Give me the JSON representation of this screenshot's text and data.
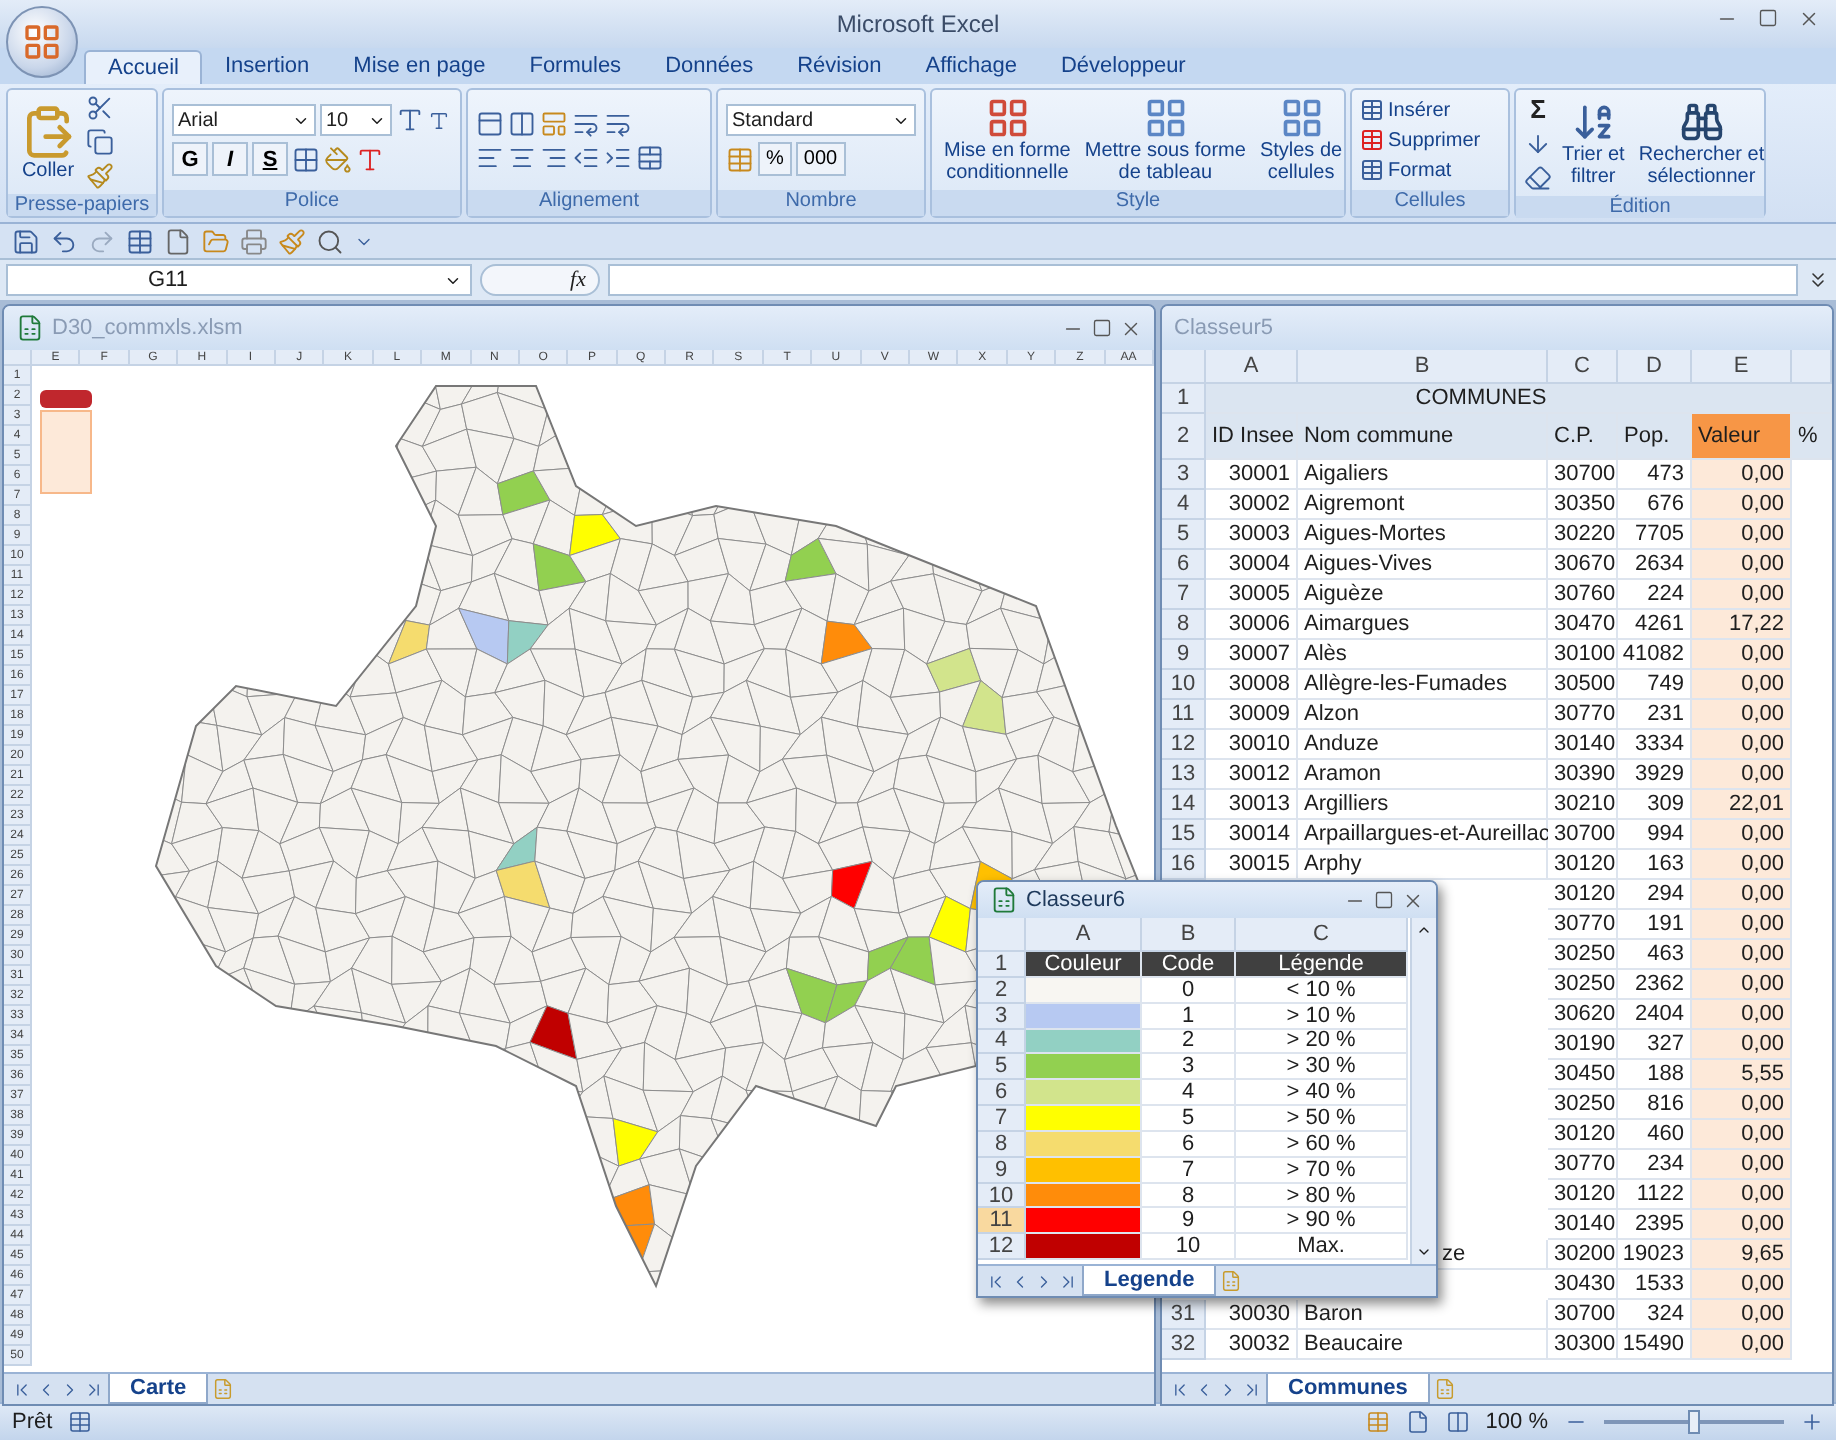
{
  "app": {
    "title": "Microsoft Excel"
  },
  "tabs": [
    {
      "label": "Accueil",
      "selected": true
    },
    {
      "label": "Insertion",
      "selected": false
    },
    {
      "label": "Mise en page",
      "selected": false
    },
    {
      "label": "Formules",
      "selected": false
    },
    {
      "label": "Données",
      "selected": false
    },
    {
      "label": "Révision",
      "selected": false
    },
    {
      "label": "Affichage",
      "selected": false
    },
    {
      "label": "Développeur",
      "selected": false
    }
  ],
  "ribbon": {
    "groups": [
      {
        "kind": "clipboard",
        "label": "Presse-papiers",
        "button": "Coller"
      },
      {
        "kind": "font",
        "label": "Police",
        "font": "Arial",
        "size": "10",
        "styles": [
          "G",
          "I",
          "S"
        ]
      },
      {
        "kind": "alignment",
        "label": "Alignement"
      },
      {
        "kind": "number",
        "label": "Nombre",
        "format": "Standard",
        "symbols": [
          "%",
          "000"
        ]
      },
      {
        "kind": "style",
        "label": "Style",
        "buttons": [
          {
            "lines": [
              "Mise en forme",
              "conditionnelle"
            ]
          },
          {
            "lines": [
              "Mettre sous forme",
              "de tableau"
            ]
          },
          {
            "lines": [
              "Styles de",
              "cellules"
            ]
          }
        ]
      },
      {
        "kind": "cells",
        "label": "Cellules",
        "buttons": [
          "Insérer",
          "Supprimer",
          "Format"
        ]
      },
      {
        "kind": "editing",
        "label": "Édition",
        "sum": "Σ",
        "buttons": [
          {
            "lines": [
              "Trier et",
              "filtrer"
            ]
          },
          {
            "lines": [
              "Rechercher et",
              "sélectionner"
            ]
          }
        ]
      }
    ]
  },
  "formula_bar": {
    "name_box": "G11",
    "function_label": "fx"
  },
  "map_window": {
    "title": "D30_commxls.xlsm",
    "active": false,
    "columns": [
      "E",
      "F",
      "G",
      "H",
      "I",
      "J",
      "K",
      "L",
      "M",
      "N",
      "O",
      "P",
      "Q",
      "R",
      "S",
      "T",
      "U",
      "V",
      "W",
      "X",
      "Y",
      "Z",
      "AA"
    ],
    "row_headers": [
      "1",
      "2",
      "3",
      "4",
      "5",
      "6",
      "7",
      "8",
      "9",
      "10",
      "11",
      "12",
      "13",
      "14",
      "15",
      "16",
      "17",
      "18",
      "19",
      "20",
      "21",
      "22",
      "23",
      "24",
      "25",
      "26",
      "27",
      "28",
      "29",
      "30",
      "31",
      "32",
      "33",
      "34",
      "35",
      "36",
      "37",
      "38",
      "39",
      "40",
      "41",
      "42",
      "43",
      "44",
      "45",
      "46",
      "47",
      "48",
      "49",
      "50"
    ],
    "sheet_tabs": [
      {
        "label": "Carte",
        "selected": true
      }
    ]
  },
  "communes_window": {
    "title": "Classeur5",
    "active": false,
    "columns": [
      "A",
      "B",
      "C",
      "D",
      "E"
    ],
    "title_row": {
      "row": "1",
      "text": "COMMUNES"
    },
    "header_row": {
      "row": "2",
      "cells": [
        "ID Insee",
        "Nom commune",
        "C.P.",
        "Pop.",
        "Valeur",
        "%"
      ]
    },
    "rows": [
      {
        "kind": "full",
        "row": "3",
        "id": "30001",
        "name": "Aigaliers",
        "cp": "30700",
        "pop": "473",
        "value": "0,00"
      },
      {
        "kind": "full",
        "row": "4",
        "id": "30002",
        "name": "Aigremont",
        "cp": "30350",
        "pop": "676",
        "value": "0,00"
      },
      {
        "kind": "full",
        "row": "5",
        "id": "30003",
        "name": "Aigues-Mortes",
        "cp": "30220",
        "pop": "7705",
        "value": "0,00"
      },
      {
        "kind": "full",
        "row": "6",
        "id": "30004",
        "name": "Aigues-Vives",
        "cp": "30670",
        "pop": "2634",
        "value": "0,00"
      },
      {
        "kind": "full",
        "row": "7",
        "id": "30005",
        "name": "Aiguèze",
        "cp": "30760",
        "pop": "224",
        "value": "0,00"
      },
      {
        "kind": "full",
        "row": "8",
        "id": "30006",
        "name": "Aimargues",
        "cp": "30470",
        "pop": "4261",
        "value": "17,22"
      },
      {
        "kind": "full",
        "row": "9",
        "id": "30007",
        "name": "Alès",
        "cp": "30100",
        "pop": "41082",
        "value": "0,00"
      },
      {
        "kind": "full",
        "row": "10",
        "id": "30008",
        "name": "Allègre-les-Fumades",
        "cp": "30500",
        "pop": "749",
        "value": "0,00"
      },
      {
        "kind": "full",
        "row": "11",
        "id": "30009",
        "name": "Alzon",
        "cp": "30770",
        "pop": "231",
        "value": "0,00"
      },
      {
        "kind": "full",
        "row": "12",
        "id": "30010",
        "name": "Anduze",
        "cp": "30140",
        "pop": "3334",
        "value": "0,00"
      },
      {
        "kind": "full",
        "row": "13",
        "id": "30012",
        "name": "Aramon",
        "cp": "30390",
        "pop": "3929",
        "value": "0,00"
      },
      {
        "kind": "full",
        "row": "14",
        "id": "30013",
        "name": "Argilliers",
        "cp": "30210",
        "pop": "309",
        "value": "22,01"
      },
      {
        "kind": "full",
        "row": "15",
        "id": "30014",
        "name": "Arpaillargues-et-Aureillac",
        "cp": "30700",
        "pop": "994",
        "value": "0,00"
      },
      {
        "kind": "full",
        "row": "16",
        "id": "30015",
        "name": "Arphy",
        "cp": "30120",
        "pop": "163",
        "value": "0,00"
      },
      {
        "kind": "covered",
        "cp": "30120",
        "pop": "294",
        "value": "0,00"
      },
      {
        "kind": "covered",
        "cp": "30770",
        "pop": "191",
        "value": "0,00"
      },
      {
        "kind": "covered",
        "cp": "30250",
        "pop": "463",
        "value": "0,00"
      },
      {
        "kind": "covered",
        "cp": "30250",
        "pop": "2362",
        "value": "0,00"
      },
      {
        "kind": "covered",
        "cp": "30620",
        "pop": "2404",
        "value": "0,00"
      },
      {
        "kind": "covered",
        "cp": "30190",
        "pop": "327",
        "value": "0,00"
      },
      {
        "kind": "covered",
        "cp": "30450",
        "pop": "188",
        "value": "5,55"
      },
      {
        "kind": "covered",
        "cp": "30250",
        "pop": "816",
        "value": "0,00"
      },
      {
        "kind": "covered",
        "cp": "30120",
        "pop": "460",
        "value": "0,00"
      },
      {
        "kind": "covered",
        "cp": "30770",
        "pop": "234",
        "value": "0,00"
      },
      {
        "kind": "covered",
        "cp": "30120",
        "pop": "1122",
        "value": "0,00"
      },
      {
        "kind": "covered",
        "cp": "30140",
        "pop": "2395",
        "value": "0,00"
      },
      {
        "kind": "covered",
        "name": "ze",
        "cp": "30200",
        "pop": "19023",
        "value": "9,65"
      },
      {
        "kind": "covered",
        "cp": "30430",
        "pop": "1533",
        "value": "0,00"
      },
      {
        "kind": "full",
        "row": "31",
        "id": "30030",
        "name": "Baron",
        "cp": "30700",
        "pop": "324",
        "value": "0,00"
      },
      {
        "kind": "full",
        "row": "32",
        "id": "30032",
        "name": "Beaucaire",
        "cp": "30300",
        "pop": "15490",
        "value": "0,00"
      }
    ],
    "sheet_tabs": [
      {
        "label": "Communes",
        "selected": true
      }
    ]
  },
  "legend_window": {
    "title": "Classeur6",
    "active": true,
    "columns": [
      "A",
      "B",
      "C"
    ],
    "header": {
      "row": "1",
      "cells": [
        "Couleur",
        "Code",
        "Légende"
      ]
    },
    "rows": [
      {
        "row": "2",
        "color": "#f8f6f2",
        "code": "0",
        "legend": "< 10 %",
        "selected": false
      },
      {
        "row": "3",
        "color": "#b7c9f2",
        "code": "1",
        "legend": "> 10 %",
        "selected": false
      },
      {
        "row": "4",
        "color": "#92d0c3",
        "code": "2",
        "legend": "> 20 %",
        "selected": false
      },
      {
        "row": "5",
        "color": "#92d050",
        "code": "3",
        "legend": "> 30 %",
        "selected": false
      },
      {
        "row": "6",
        "color": "#d2e48c",
        "code": "4",
        "legend": "> 40 %",
        "selected": false
      },
      {
        "row": "7",
        "color": "#ffff00",
        "code": "5",
        "legend": "> 50 %",
        "selected": false
      },
      {
        "row": "8",
        "color": "#f5dc6e",
        "code": "6",
        "legend": "> 60 %",
        "selected": false
      },
      {
        "row": "9",
        "color": "#ffc000",
        "code": "7",
        "legend": "> 70 %",
        "selected": false
      },
      {
        "row": "10",
        "color": "#ff8c0a",
        "code": "8",
        "legend": "> 80 %",
        "selected": false
      },
      {
        "row": "11",
        "color": "#ff0000",
        "code": "9",
        "legend": "> 90 %",
        "selected": true
      },
      {
        "row": "12",
        "color": "#c00000",
        "code": "10",
        "legend": "Max.",
        "selected": false
      }
    ],
    "sheet_tabs": [
      {
        "label": "Legende",
        "selected": true
      }
    ]
  },
  "status_bar": {
    "text": "Prêt",
    "zoom": "100 %",
    "zoom_slider": {
      "level": 0.5
    }
  }
}
